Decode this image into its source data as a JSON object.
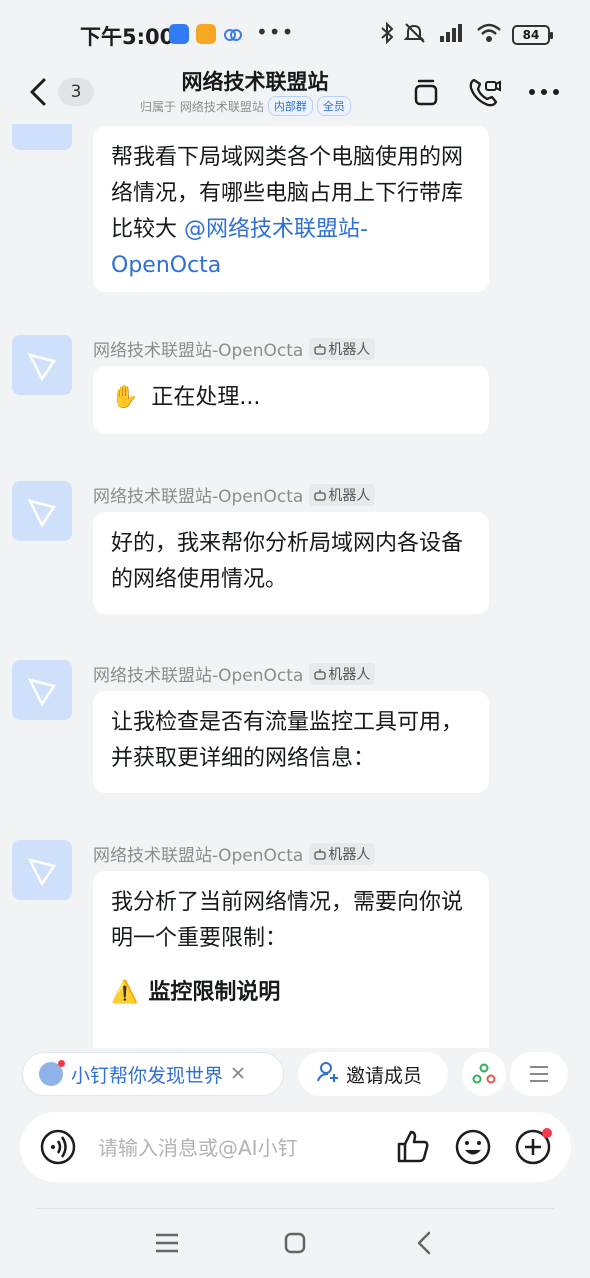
{
  "status_bar": {
    "time": "下午5:00",
    "battery": "84"
  },
  "header": {
    "back_count": "3",
    "title": "网络技术联盟站",
    "belongs_to": "归属于 网络技术联盟站",
    "tags": [
      "内部群",
      "全员"
    ]
  },
  "messages": [
    {
      "type": "user",
      "text": "帮我看下局域网类各个电脑使用的网络情况，有哪些电脑占用上下行带库比较大 ",
      "mention": "@网络技术联盟站-OpenOcta"
    },
    {
      "type": "bot",
      "sender": "网络技术联盟站-OpenOcta",
      "badge": "机器人",
      "emoji": "✋",
      "text": "正在处理..."
    },
    {
      "type": "bot",
      "sender": "网络技术联盟站-OpenOcta",
      "badge": "机器人",
      "text": "好的，我来帮你分析局域网内各设备的网络使用情况。"
    },
    {
      "type": "bot",
      "sender": "网络技术联盟站-OpenOcta",
      "badge": "机器人",
      "text": "让我检查是否有流量监控工具可用，并获取更详细的网络信息："
    },
    {
      "type": "bot",
      "sender": "网络技术联盟站-OpenOcta",
      "badge": "机器人",
      "text": "我分析了当前网络情况，需要向你说明一个重要限制：",
      "heading_emoji": "⚠️",
      "heading": "监控限制说明"
    }
  ],
  "quick_actions": {
    "discover": "小钉帮你发现世界",
    "invite": "邀请成员"
  },
  "input": {
    "placeholder": "请输入消息或@AI小钉"
  },
  "colors": {
    "accent": "#2f6fd6",
    "background": "#f2f3f5",
    "bubble": "#ffffff",
    "notification": "#f5384a"
  }
}
